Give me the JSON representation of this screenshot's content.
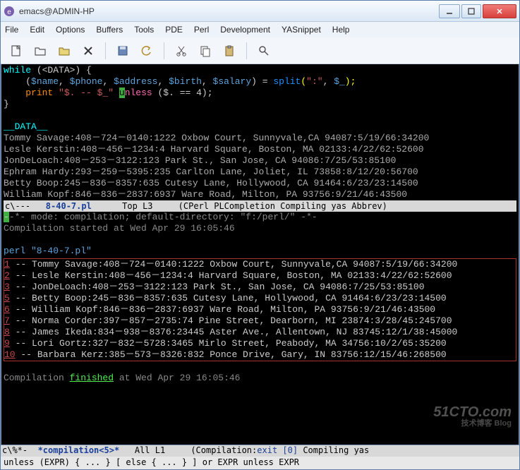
{
  "window": {
    "title": "emacs@ADMIN-HP"
  },
  "menubar": {
    "file": "File",
    "edit": "Edit",
    "options": "Options",
    "buffers": "Buffers",
    "tools": "Tools",
    "pde": "PDE",
    "perl": "Perl",
    "development": "Development",
    "yasnippet": "YASnippet",
    "help": "Help"
  },
  "code": {
    "l1_kw": "while",
    "l1_rest1": " (<DATA>) {",
    "l2_indent": "    (",
    "l2_v1": "$name",
    "l2_c1": ", ",
    "l2_v2": "$phone",
    "l2_c2": ", ",
    "l2_v3": "$address",
    "l2_c3": ", ",
    "l2_v4": "$birth",
    "l2_c4": ", ",
    "l2_v5": "$salary",
    "l2_c5": ") = ",
    "l2_split": "split",
    "l2_args_open": "(",
    "l2_str": "\":\"",
    "l2_sep": ", ",
    "l2_uv": "$_",
    "l2_close": ");",
    "l3_indent": "    ",
    "l3_print": "print",
    "l3_sp": " ",
    "l3_str1": "\"$. -- $_\"",
    "l3_cursor": "u",
    "l3_unless": "nless",
    "l3_cond": " ($. == 4);",
    "l4": "}",
    "blank": "",
    "data_marker": "__DATA__",
    "d1": "Tommy Savage:408－724－0140:1222 Oxbow Court, Sunnyvale,CA 94087:5/19/66:34200",
    "d2": "Lesle Kerstin:408－456－1234:4 Harvard Square, Boston, MA 02133:4/22/62:52600",
    "d3": "JonDeLoach:408－253－3122:123 Park St., San Jose, CA 94086:7/25/53:85100",
    "d4": "Ephram Hardy:293－259－5395:235 Carlton Lane, Joliet, IL 73858:8/12/20:56700",
    "d5": "Betty Boop:245－836－8357:635 Cutesy Lane, Hollywood, CA 91464:6/23/23:14500",
    "d6": "William Kopf:846－836－2837:6937 Ware Road, Milton, PA 93756:9/21/46:43500"
  },
  "modeline1": {
    "prefix": "c\\---   ",
    "file": "8-40-7.pl",
    "mid": "      Top L3     ",
    "mode": "(CPerl PLCompletion Compiling yas Abbrev)"
  },
  "compile": {
    "head_a": "-*- mode: compilation; default-directory: ",
    "head_b": "\"f:/perl/\"",
    "head_c": " -*-",
    "started": "Compilation started at Wed Apr 29 16:05:46",
    "cmd": "perl \"8-40-7.pl\"",
    "finished_a": "Compilation ",
    "finished_b": "finished",
    "finished_c": " at Wed Apr 29 16:05:46",
    "out": [
      {
        "n": "1",
        "t": " -- Tommy Savage:408－724－0140:1222 Oxbow Court, Sunnyvale,CA 94087:5/19/66:34200"
      },
      {
        "n": "2",
        "t": " -- Lesle Kerstin:408－456－1234:4 Harvard Square, Boston, MA 02133:4/22/62:52600"
      },
      {
        "n": "3",
        "t": " -- JonDeLoach:408－253－3122:123 Park St., San Jose, CA 94086:7/25/53:85100"
      },
      {
        "n": "5",
        "t": " -- Betty Boop:245－836－8357:635 Cutesy Lane, Hollywood, CA 91464:6/23/23:14500"
      },
      {
        "n": "6",
        "t": " -- William Kopf:846－836－2837:6937 Ware Road, Milton, PA 93756:9/21/46:43500"
      },
      {
        "n": "7",
        "t": " -- Norma Corder:397－857－2735:74 Pine Street, Dearborn, MI 23874:3/28/45:245700"
      },
      {
        "n": "8",
        "t": " -- James Ikeda:834－938－8376:23445 Aster Ave., Allentown, NJ 83745:12/1/38:45000"
      },
      {
        "n": "9",
        "t": " -- Lori Gortz:327－832－5728:3465 Mirlo Street, Peabody, MA 34756:10/2/65:35200"
      },
      {
        "n": "10",
        "t": " -- Barbara Kerz:385－573－8326:832 Ponce Drive, Gary, IN 83756:12/15/46:268500"
      }
    ]
  },
  "modeline2": {
    "prefix": "c\\%*-  ",
    "file": "*compilation<5>*",
    "mid": "   All L1     (",
    "mode_a": "Compilation",
    "colon": ":",
    "exit": "exit",
    "sp": " ",
    "zero": "[0]",
    "tail": " Compiling yas"
  },
  "minibuffer": {
    "text": "unless (EXPR) { ... } [ else { ... } ] or EXPR unless EXPR"
  },
  "watermark": {
    "main": "51CTO.com",
    "sub": "技术博客   Blog"
  }
}
